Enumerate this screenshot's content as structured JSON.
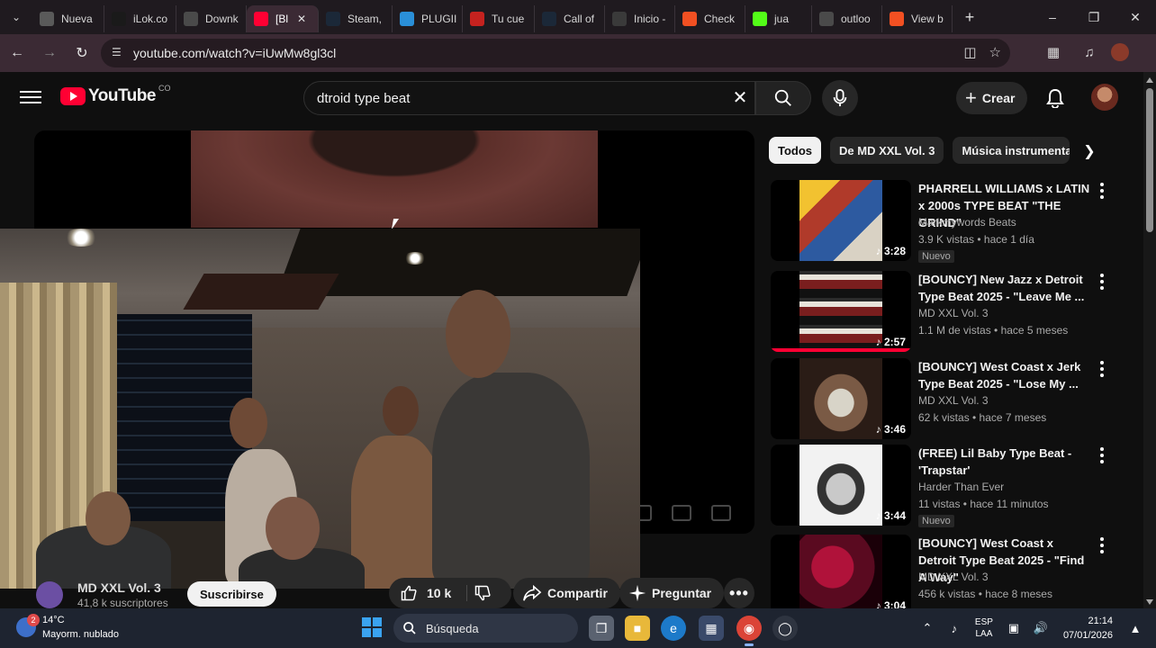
{
  "browser": {
    "tabs": [
      {
        "label": "Nueva",
        "fav_color": "#5a5a5a"
      },
      {
        "label": "iLok.co",
        "fav_color": "#1a1a1a"
      },
      {
        "label": "Downk",
        "fav_color": "#4a4a4a"
      },
      {
        "label": "[Bl",
        "fav_color": "#ff0033"
      },
      {
        "label": "Steam,",
        "fav_color": "#1b2838"
      },
      {
        "label": "PLUGII",
        "fav_color": "#2a8fd8"
      },
      {
        "label": "Tu cue",
        "fav_color": "#c5221f"
      },
      {
        "label": "Call of",
        "fav_color": "#1b2838"
      },
      {
        "label": "Inicio -",
        "fav_color": "#3a3a3a"
      },
      {
        "label": "Check",
        "fav_color": "#f25022"
      },
      {
        "label": "jua",
        "fav_color": "#53fc18"
      },
      {
        "label": "outloo",
        "fav_color": "#4a4a4a"
      },
      {
        "label": "View b",
        "fav_color": "#f25022"
      }
    ],
    "active_tab_index": 3,
    "url": "youtube.com/watch?v=iUwMw8gl3cl"
  },
  "youtube": {
    "logo_text": "YouTube",
    "country_code": "CO",
    "search_query": "dtroid type beat",
    "create_label": "Crear"
  },
  "video": {
    "channel_name": "MD XXL Vol. 3",
    "subscribers": "41,8 k suscriptores",
    "subscribe_label": "Suscribirse",
    "likes": "10 k",
    "share_label": "Compartir",
    "ask_label": "Preguntar"
  },
  "chips": [
    "Todos",
    "De MD XXL Vol. 3",
    "Música instrumental"
  ],
  "recommendations": [
    {
      "title": "PHARRELL WILLIAMS x LATIN x 2000s TYPE BEAT \"THE GRIND\"",
      "channel": "Markmywords Beats",
      "meta": "3.9 K vistas • hace 1 día",
      "badge": "Nuevo",
      "duration": "3:28"
    },
    {
      "title": "[BOUNCY] New Jazz x Detroit Type Beat 2025 - \"Leave Me ...",
      "channel": "MD XXL Vol. 3",
      "meta": "1.1 M de vistas • hace 5 meses",
      "badge": "",
      "duration": "2:57",
      "watched": 1
    },
    {
      "title": "[BOUNCY] West Coast x Jerk Type Beat 2025 - \"Lose My ...",
      "channel": "MD XXL Vol. 3",
      "meta": "62 k vistas • hace 7 meses",
      "badge": "",
      "duration": "3:46"
    },
    {
      "title": "(FREE) Lil Baby Type Beat - 'Trapstar'",
      "channel": "Harder Than Ever",
      "meta": "11 vistas • hace 11 minutos",
      "badge": "Nuevo",
      "duration": "3:44"
    },
    {
      "title": "[BOUNCY] West Coast x Detroit Type Beat 2025 - \"Find A Way\"",
      "channel": "MD XXL Vol. 3",
      "meta": "456 k vistas • hace 8 meses",
      "badge": "",
      "duration": "3:04"
    }
  ],
  "taskbar": {
    "weather_badge": "2",
    "temperature": "14°C",
    "weather_condition": "Mayorm. nublado",
    "search_label": "Búsqueda",
    "lang_top": "ESP",
    "lang_bottom": "LAA",
    "time": "21:14",
    "date": "07/01/2026"
  },
  "colors": {
    "accent": "#ff0033",
    "background": "#0f0f0f"
  }
}
